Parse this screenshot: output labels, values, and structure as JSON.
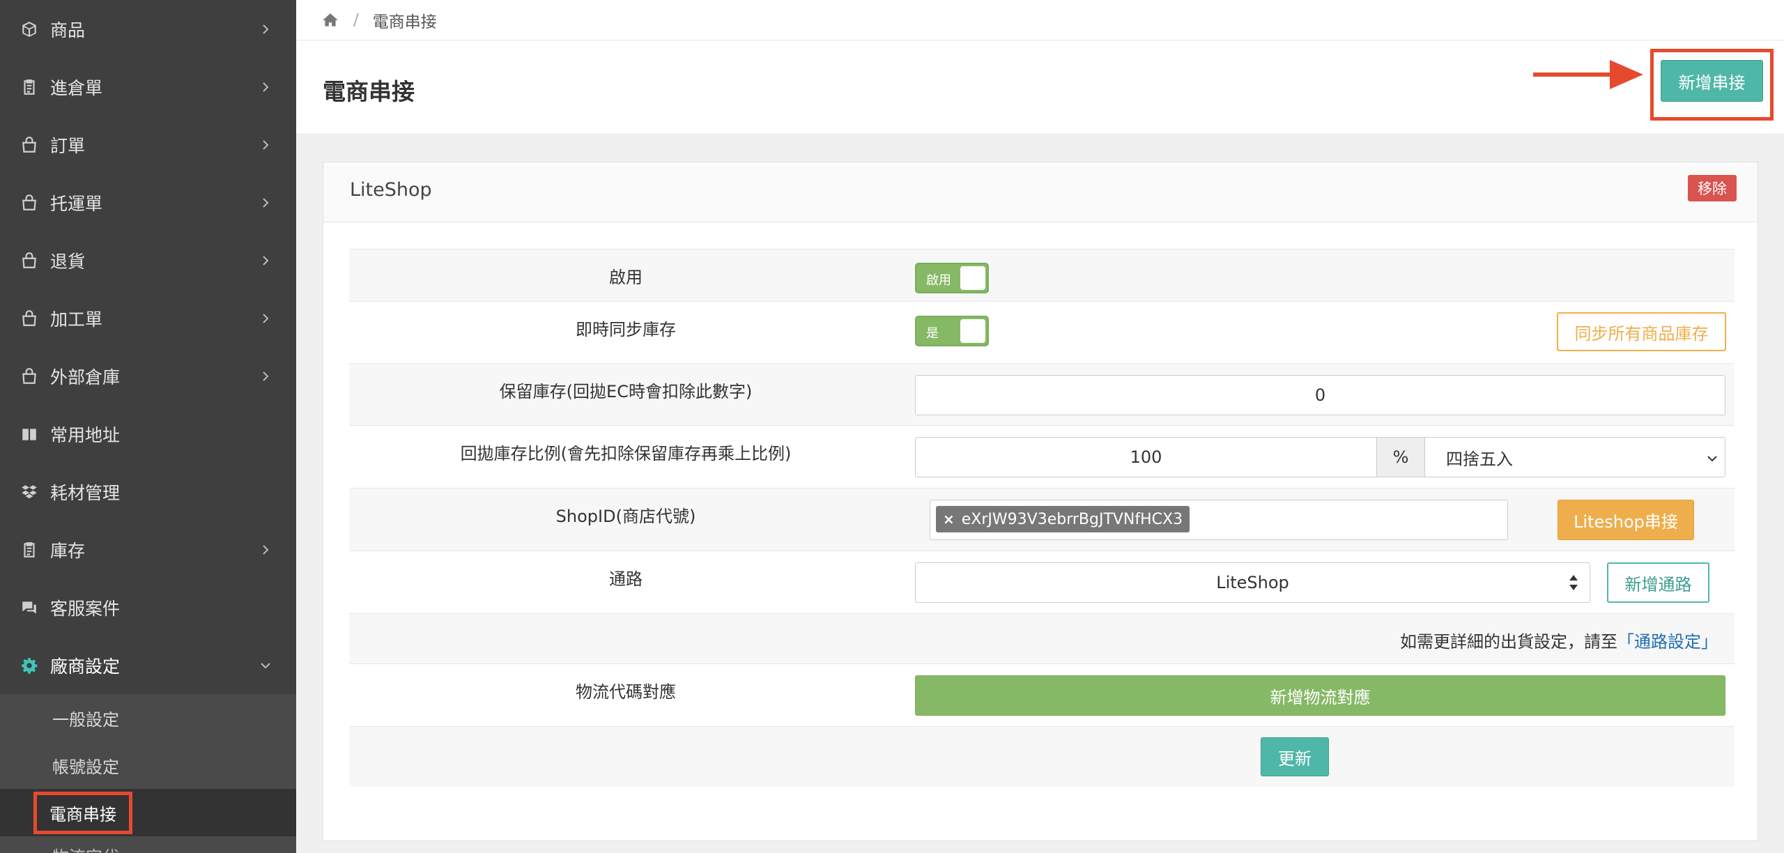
{
  "sidebar": {
    "items": [
      {
        "label": "商品",
        "icon": "box-icon"
      },
      {
        "label": "進倉單",
        "icon": "clipboard-icon"
      },
      {
        "label": "訂單",
        "icon": "bag-icon"
      },
      {
        "label": "托運單",
        "icon": "bag-icon"
      },
      {
        "label": "退貨",
        "icon": "bag-icon"
      },
      {
        "label": "加工單",
        "icon": "bag-icon"
      },
      {
        "label": "外部倉庫",
        "icon": "bag-icon"
      },
      {
        "label": "常用地址",
        "icon": "book-icon"
      },
      {
        "label": "耗材管理",
        "icon": "dropbox-icon"
      },
      {
        "label": "庫存",
        "icon": "clipboard-icon"
      },
      {
        "label": "客服案件",
        "icon": "chat-icon"
      },
      {
        "label": "廠商設定",
        "icon": "gear-icon"
      }
    ],
    "subitems": [
      "一般設定",
      "帳號設定",
      "電商串接",
      "物流定代"
    ]
  },
  "breadcrumb": {
    "current": "電商串接"
  },
  "page": {
    "title": "電商串接",
    "add_button": "新增串接"
  },
  "panel": {
    "title": "LiteShop",
    "remove_button": "移除",
    "rows": {
      "enable": {
        "label": "啟用",
        "toggle_text": "啟用"
      },
      "realtime_sync": {
        "label": "即時同步庫存",
        "toggle_text": "是",
        "sync_all_button": "同步所有商品庫存"
      },
      "reserve_stock": {
        "label": "保留庫存(回拋EC時會扣除此數字)",
        "value": "0"
      },
      "ratio": {
        "label": "回拋庫存比例(會先扣除保留庫存再乘上比例)",
        "value": "100",
        "unit": "%",
        "rounding": "四捨五入"
      },
      "shopid": {
        "label": "ShopID(商店代號)",
        "tag": "eXrJW93V3ebrrBgJTVNfHCX3",
        "connect_button": "Liteshop串接"
      },
      "channel": {
        "label": "通路",
        "value": "LiteShop",
        "add_button": "新增通路"
      },
      "note": {
        "text": "如需更詳細的出貨設定，請至",
        "link": "「通路設定」"
      },
      "logistics": {
        "label": "物流代碼對應",
        "add_button": "新增物流對應"
      },
      "update_button": "更新"
    }
  },
  "colors": {
    "sidebar_bg": "#3f3f3f",
    "teal": "#4fb7a8",
    "green": "#86b966",
    "orange": "#efae4c",
    "red": "#d9534f",
    "highlight": "#e64a2e"
  }
}
